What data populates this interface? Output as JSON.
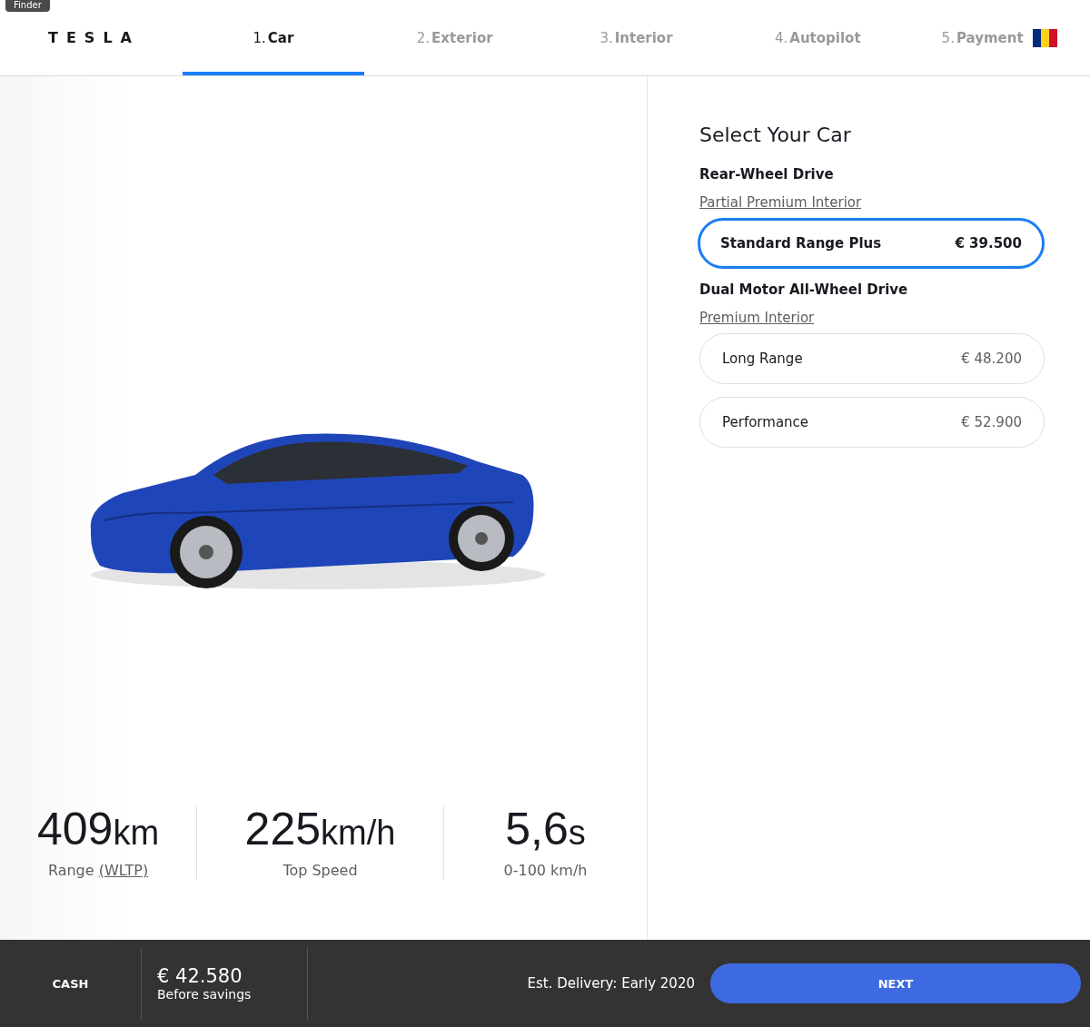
{
  "tooltip": {
    "label": "Finder"
  },
  "logo": {
    "text": "TESLA"
  },
  "steps": [
    {
      "number": "1.",
      "label": "Car",
      "selected": true
    },
    {
      "number": "2.",
      "label": "Exterior",
      "selected": false
    },
    {
      "number": "3.",
      "label": "Interior",
      "selected": false
    },
    {
      "number": "4.",
      "label": "Autopilot",
      "selected": false
    },
    {
      "number": "5.",
      "label": "Payment",
      "selected": false
    }
  ],
  "stats": [
    {
      "value": "409",
      "unit": "km",
      "label": "Range",
      "link": "(WLTP)"
    },
    {
      "value": "225",
      "unit": "km/h",
      "label": "Top Speed"
    },
    {
      "value": "5,6",
      "unit": "s",
      "label": "0-100 km/h"
    }
  ],
  "panel": {
    "title": "Select Your Car",
    "groups": [
      {
        "name": "Rear-Wheel Drive",
        "interior": "Partial Premium Interior",
        "options": [
          {
            "name": "Standard Range Plus",
            "price": "€ 39.500",
            "selected": true
          }
        ]
      },
      {
        "name": "Dual Motor All-Wheel Drive",
        "interior": "Premium Interior",
        "options": [
          {
            "name": "Long Range",
            "price": "€ 48.200",
            "selected": false
          },
          {
            "name": "Performance",
            "price": "€ 52.900",
            "selected": false
          }
        ]
      }
    ]
  },
  "footer": {
    "payment": "CASH",
    "price": "€ 42.580",
    "price_note": "Before savings",
    "delivery": "Est. Delivery: Early 2020",
    "button": "NEXT"
  }
}
